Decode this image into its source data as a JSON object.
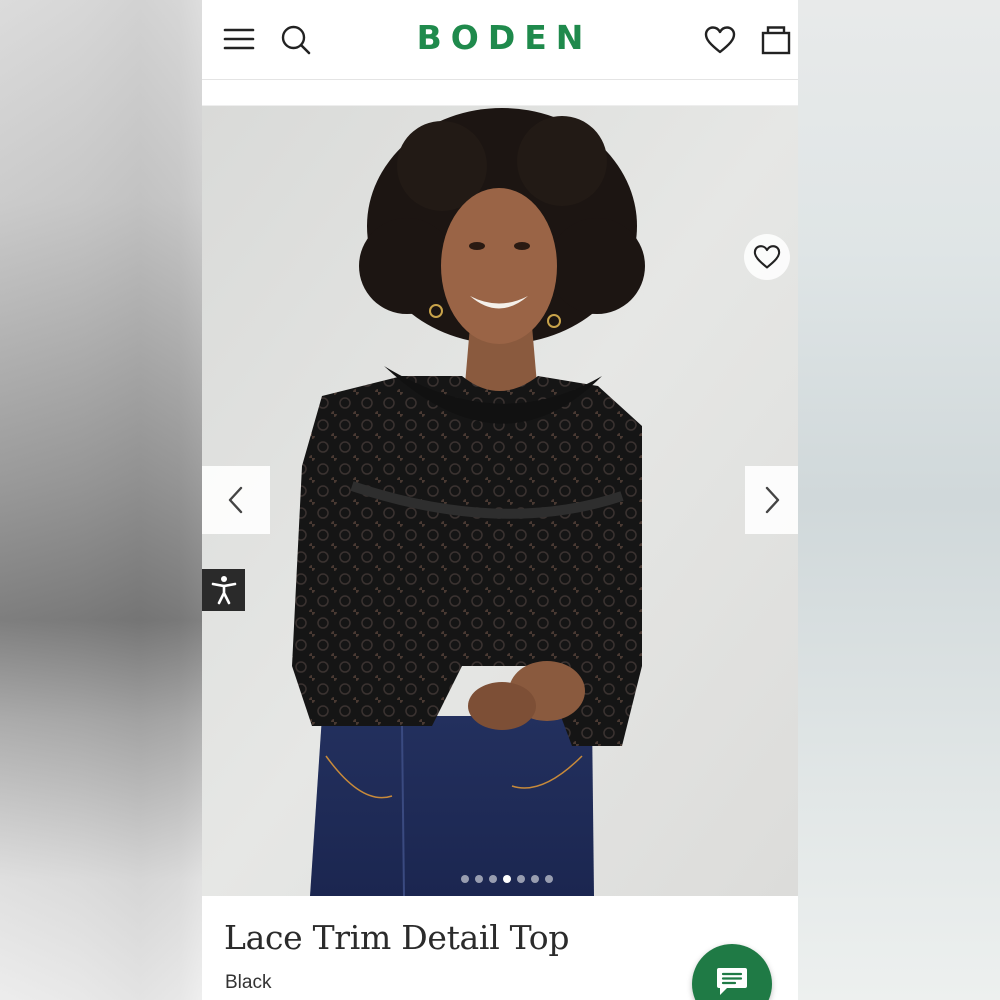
{
  "header": {
    "logo": "BODEN",
    "logo_color": "#1f8a4c",
    "menu_icon": "hamburger-menu-icon",
    "search_icon": "search-icon",
    "wishlist_icon": "heart-icon",
    "bag_icon": "shopping-bag-icon"
  },
  "gallery": {
    "favourite_icon": "heart-icon",
    "prev_icon": "chevron-left-icon",
    "next_icon": "chevron-right-icon",
    "accessibility_icon": "accessibility-person-icon",
    "image_count": 7,
    "active_image": 4
  },
  "product": {
    "title": "Lace Trim Detail Top",
    "color": "Black"
  },
  "chat": {
    "icon": "chat-bubble-icon",
    "color": "#1f7a45"
  },
  "colors": {
    "text": "#2b2b2b",
    "icon": "#222222"
  }
}
